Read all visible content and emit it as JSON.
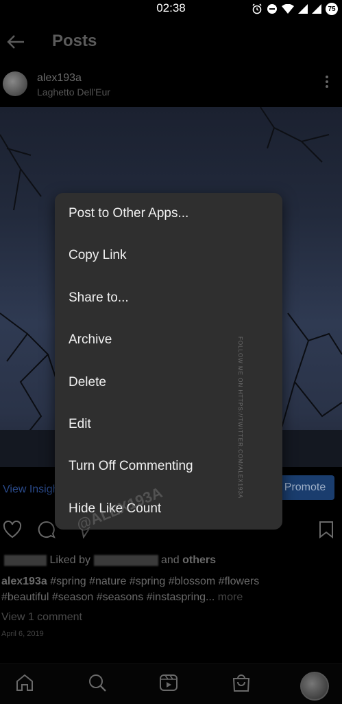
{
  "status_bar": {
    "time": "02:38",
    "battery": "75"
  },
  "header": {
    "title": "Posts"
  },
  "post": {
    "username": "alex193a",
    "location": "Laghetto Dell'Eur",
    "view_insights": "View Insights",
    "promote": "Promote",
    "liked_by_prefix": "Liked by",
    "liked_by_and": "and",
    "liked_by_others": "others",
    "caption_user": "alex193a",
    "caption_line1": "#spring #nature #spring #blossom #flowers",
    "caption_line2": "#beautiful #season #seasons #instaspring...",
    "caption_more": "more",
    "view_comments": "View 1 comment",
    "date": "April 6, 2019"
  },
  "menu": {
    "items": [
      "Post to Other Apps...",
      "Copy Link",
      "Share to...",
      "Archive",
      "Delete",
      "Edit",
      "Turn Off Commenting",
      "Hide Like Count"
    ]
  },
  "watermarks": {
    "vertical": "FOLLOW ME ON HTTPS://TWITTER.COM/ALEX193A",
    "diagonal": "@ALEX193A"
  },
  "colors": {
    "menu_bg": "#2f2f2f",
    "page_bg": "#000000",
    "promote_bg": "#1a3d6e"
  }
}
